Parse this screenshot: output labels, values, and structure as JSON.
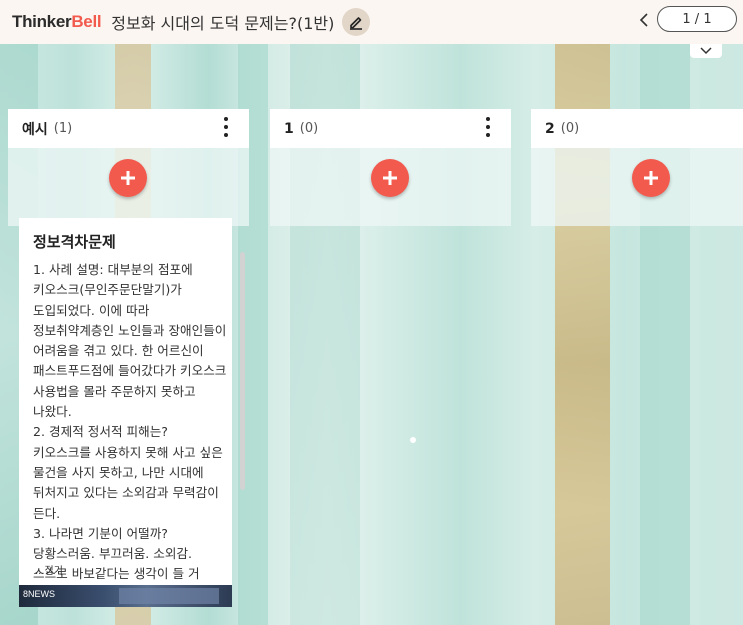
{
  "header": {
    "logo_part1": "Thinker",
    "logo_part2": "Bell",
    "title": "정보화 시대의 도덕 문제는?(1반)",
    "page_indicator": "1 / 1"
  },
  "columns": [
    {
      "title": "예시",
      "count": "(1)"
    },
    {
      "title": "1",
      "count": "(0)"
    },
    {
      "title": "2",
      "count": "(0)"
    }
  ],
  "post": {
    "title": "정보격차문제",
    "body": "1. 사례 설명: 대부분의 점포에 키오스크(무인주문단말기)가 도입되었다. 이에 따라 정보취약계층인 노인들과 장애인들이 어려움을 겪고 있다. 한 어르신이 패스트푸드점에 들어갔다가 키오스크 사용법을 몰라 주문하지 못하고 나왔다.\n2. 경제적 정서적 피해는? 키오스크를 사용하지 못해 사고 싶은 물건을 사지 못하고, 나만 시대에 뒤처지고 있다는 소외감과 무력감이 든다.\n3. 나라면 기분이 어떨까? 당황스러움. 부끄러움. 소외감. 스스로 바보같다는 생각이 들 거 같다.",
    "fold_label": "...접기",
    "thumb_logo": "8NEWS"
  },
  "colors": {
    "accent": "#f25a4e",
    "header_bg": "#fbf6f1",
    "background": "#bfe3dc"
  },
  "icons": {
    "edit": "pencil-icon",
    "prev": "chevron-left-icon",
    "collapse": "chevron-down-icon",
    "add": "plus-icon",
    "menu": "kebab-menu-icon"
  }
}
